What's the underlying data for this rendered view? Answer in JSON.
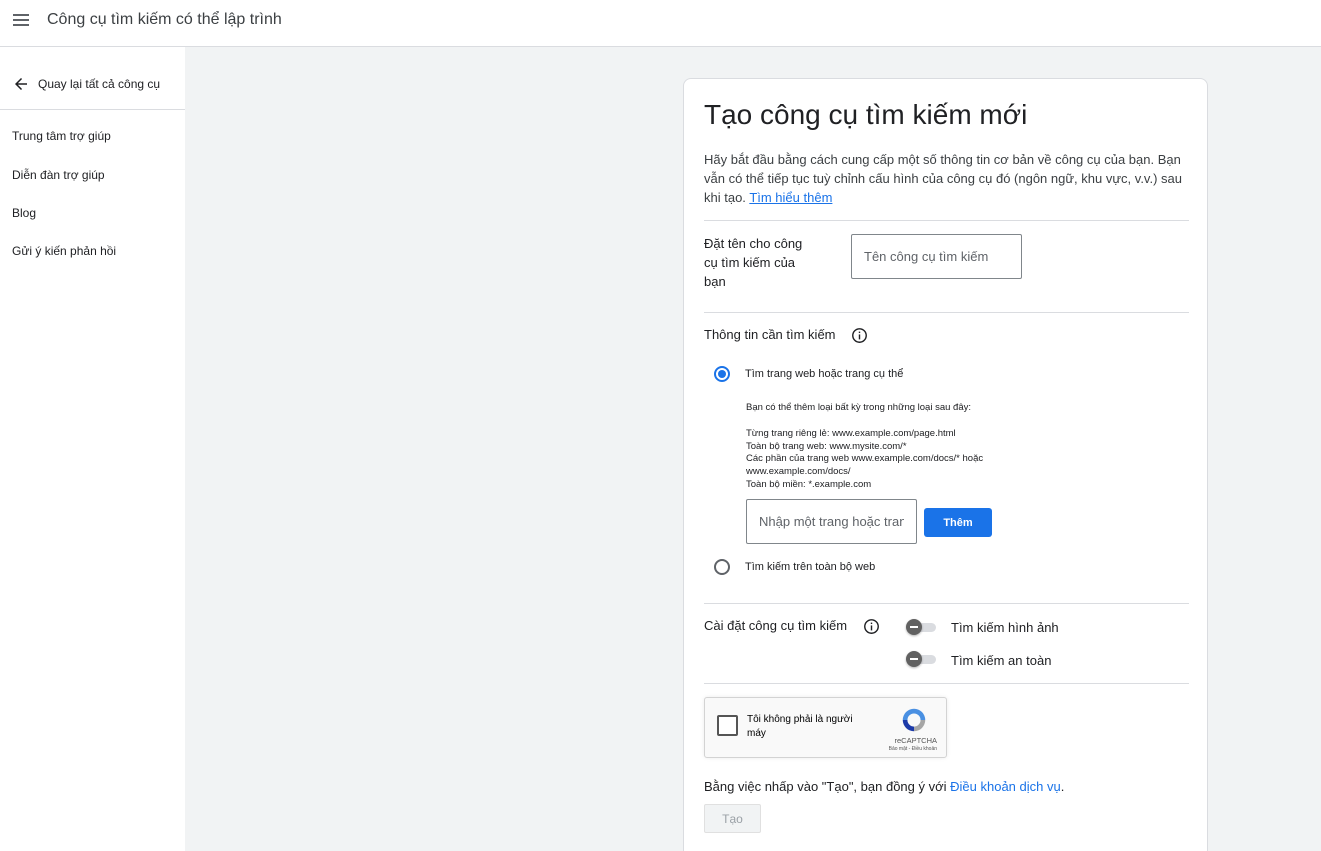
{
  "header": {
    "title": "Công cụ tìm kiếm có thể lập trình",
    "menu_icon": "menu-icon"
  },
  "sidebar": {
    "back_label": "Quay lại tất cả công cụ",
    "items": [
      {
        "label": "Trung tâm trợ giúp"
      },
      {
        "label": "Diễn đàn trợ giúp"
      },
      {
        "label": "Blog"
      },
      {
        "label": "Gửi ý kiến phản hồi"
      }
    ]
  },
  "form": {
    "title": "Tạo công cụ tìm kiếm mới",
    "intro": "Hãy bắt đầu bằng cách cung cấp một số thông tin cơ bản về công cụ của bạn. Bạn vẫn có thể tiếp tục tuỳ chỉnh cấu hình của công cụ đó (ngôn ngữ, khu vực, v.v.) sau khi tạo.",
    "learn_more": "Tìm hiểu thêm",
    "name_label": "Đặt tên cho công cụ tìm kiếm của bạn",
    "name_placeholder": "Tên công cụ tìm kiếm",
    "search_what_label": "Thông tin cần tìm kiếm",
    "option_specific": "Tìm trang web hoặc trang cụ thể",
    "hint_intro": "Bạn có thể thêm loại bất kỳ trong những loại sau đây:",
    "hint_lines": [
      "Từng trang riêng lẻ: www.example.com/page.html",
      "Toàn bộ trang web: www.mysite.com/*",
      "Các phần của trang web www.example.com/docs/* hoặc",
      "www.example.com/docs/",
      "Toàn bộ miền: *.example.com"
    ],
    "site_placeholder": "Nhập một trang hoặc trang web",
    "add_label": "Thêm",
    "option_entire_web": "Tìm kiếm trên toàn bộ web",
    "settings_label": "Cài đặt công cụ tìm kiếm",
    "toggle_images": "Tìm kiếm hình ảnh",
    "toggle_safe": "Tìm kiếm an toàn",
    "selected_option": "specific"
  },
  "captcha": {
    "label": "Tôi không phải là người máy",
    "brand": "reCAPTCHA",
    "links": "Bảo mật - Điều khoản"
  },
  "terms": {
    "prefix": "Bằng việc nhấp vào \"Tạo\", bạn đồng ý với ",
    "link": "Điều khoản dịch vụ",
    "suffix": "."
  },
  "create_label": "Tạo",
  "colors": {
    "accent": "#1a73e8",
    "background": "#f1f3f4"
  }
}
